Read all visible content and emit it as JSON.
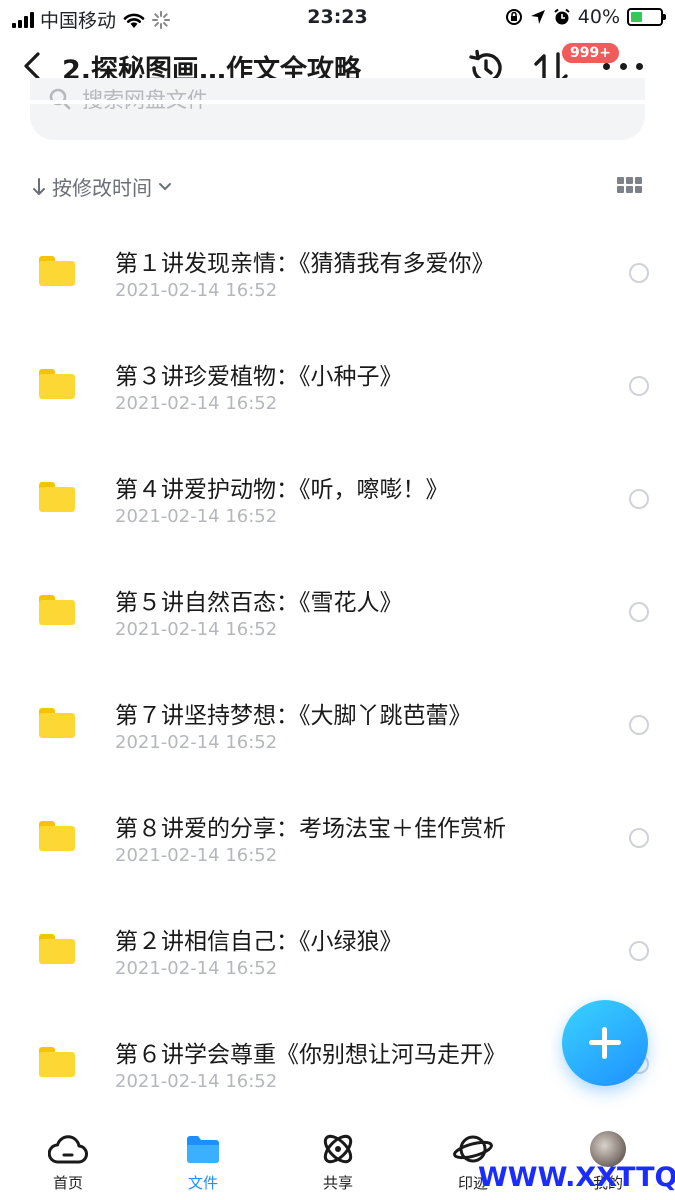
{
  "status_bar": {
    "carrier": "中国移动",
    "time": "23:23",
    "battery": "40%",
    "battery_level": 0.4
  },
  "nav": {
    "title": "2.探秘图画…作文全攻略",
    "badge": "999+",
    "icons": [
      "back-icon",
      "history-icon",
      "transfer-icon",
      "more-icon"
    ]
  },
  "search": {
    "placeholder": "搜索网盘文件"
  },
  "sort": {
    "label": "按修改时间"
  },
  "files": [
    {
      "name": "第１讲发现亲情：《猜猜我有多爱你》",
      "date": "2021-02-14 16:52"
    },
    {
      "name": "第３讲珍爱植物：《小种子》",
      "date": "2021-02-14 16:52"
    },
    {
      "name": "第４讲爱护动物：《听，嚓嘭！》",
      "date": "2021-02-14 16:52"
    },
    {
      "name": "第５讲自然百态：《雪花人》",
      "date": "2021-02-14 16:52"
    },
    {
      "name": "第７讲坚持梦想：《大脚丫跳芭蕾》",
      "date": "2021-02-14 16:52"
    },
    {
      "name": "第８讲爱的分享：考场法宝＋佳作赏析",
      "date": "2021-02-14 16:52"
    },
    {
      "name": "第２讲相信自己：《小绿狼》",
      "date": "2021-02-14 16:52"
    },
    {
      "name": "第６讲学会尊重《你别想让河马走开》",
      "date": "2021-02-14 16:52"
    }
  ],
  "tabbar": {
    "items": [
      {
        "label": "首页",
        "icon": "cloud-icon"
      },
      {
        "label": "文件",
        "icon": "folder-icon"
      },
      {
        "label": "共享",
        "icon": "share-icon"
      },
      {
        "label": "印迹",
        "icon": "planet-icon"
      },
      {
        "label": "我的",
        "icon": "avatar"
      }
    ],
    "active": "文件"
  },
  "watermark": "WWW.XXTTQ.COM",
  "colors": {
    "accent": "#1e8fff",
    "folder": "#fdd835",
    "badge": "#f25b59"
  }
}
